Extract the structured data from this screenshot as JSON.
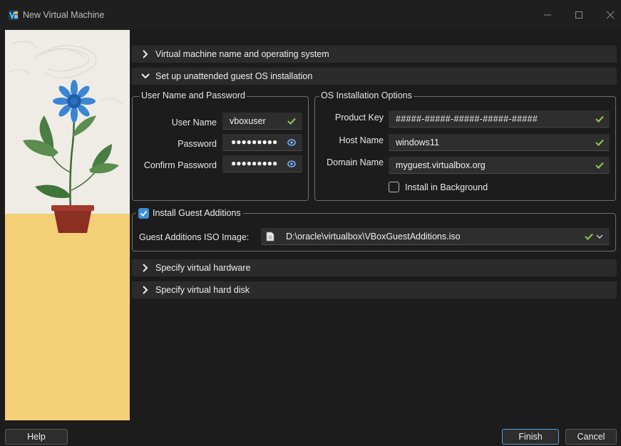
{
  "window": {
    "title": "New Virtual Machine"
  },
  "sections": {
    "name_os": "Virtual machine name and operating system",
    "unattended": "Set up unattended guest OS installation",
    "hardware": "Specify virtual hardware",
    "harddisk": "Specify virtual hard disk"
  },
  "user_group": {
    "title": "User Name and Password",
    "username_label": "User Name",
    "username_value": "vboxuser",
    "password_label": "Password",
    "password_value": "●●●●●●●●●",
    "confirm_label": "Confirm Password",
    "confirm_value": "●●●●●●●●●"
  },
  "os_group": {
    "title": "OS Installation Options",
    "product_key_label": "Product Key",
    "product_key_value": "#####-#####-#####-#####-#####",
    "host_name_label": "Host Name",
    "host_name_value": "windows11",
    "domain_name_label": "Domain Name",
    "domain_name_value": "myguest.virtualbox.org",
    "install_bg_label": "Install in Background",
    "install_bg_checked": false
  },
  "guest_additions": {
    "title": "Install Guest Additions",
    "checked": true,
    "iso_label": "Guest Additions ISO Image:",
    "iso_value": "D:\\oracle\\virtualbox\\VBoxGuestAdditions.iso"
  },
  "buttons": {
    "help": "Help",
    "finish": "Finish",
    "cancel": "Cancel"
  },
  "colors": {
    "accent": "#3d8fd6",
    "check_green": "#8bc34a",
    "background": "#1c1c1c"
  },
  "icons": [
    "virtualbox-icon",
    "minimize-icon",
    "maximize-icon",
    "close-icon",
    "chevron-right-icon",
    "chevron-down-icon",
    "check-icon",
    "eye-icon",
    "disc-file-icon",
    "dropdown-chevron-icon"
  ]
}
